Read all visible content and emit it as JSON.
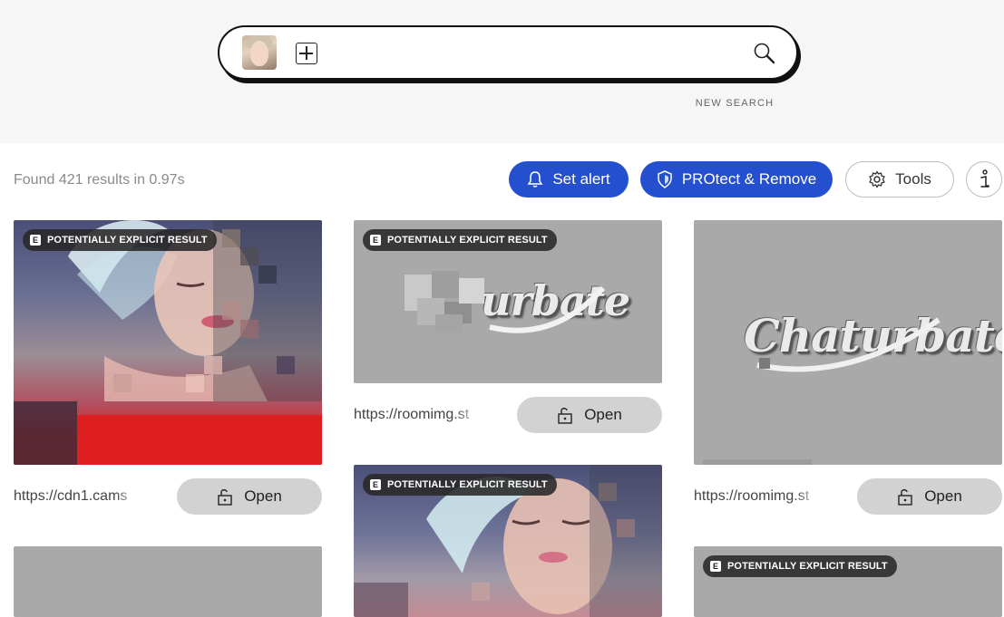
{
  "search": {
    "new_search_label": "NEW SEARCH"
  },
  "results": {
    "count_text": "Found 421 results in 0.97s"
  },
  "toolbar": {
    "set_alert_label": "Set alert",
    "protect_label": "PROtect & Remove",
    "tools_label": "Tools"
  },
  "badge_text": "POTENTIALLY EXPLICIT RESULT",
  "badge_letter": "E",
  "cards": [
    {
      "url": "https://cdn1.cams",
      "open_label": "Open"
    },
    {
      "url": "https://roomimg.st",
      "open_label": "Open",
      "logo": "urbate"
    },
    {
      "url": "https://roomimg.st",
      "open_label": "Open",
      "logo": "Chaturbate"
    }
  ],
  "colors": {
    "accent": "#2450d0",
    "card_grey": "#a9a9a9",
    "open_button": "#d2d2d2"
  }
}
